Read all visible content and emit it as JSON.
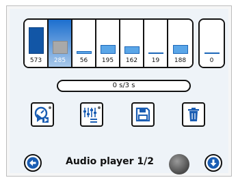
{
  "meters": [
    {
      "value": "573",
      "level": 0.82
    },
    {
      "value": "285",
      "level": 0.41
    },
    {
      "value": "56",
      "level": 0.08
    },
    {
      "value": "195",
      "level": 0.28
    },
    {
      "value": "162",
      "level": 0.23
    },
    {
      "value": "19",
      "level": 0.03
    },
    {
      "value": "188",
      "level": 0.27
    }
  ],
  "selected_meter_index": 1,
  "mute_meter": {
    "value": "0",
    "level": 0.02
  },
  "time": "0 s/3 s",
  "title": "Audio player 1/2",
  "icons": {
    "play": "play-timer-icon",
    "equalizer": "equalizer-icon",
    "save": "save-icon",
    "delete": "trash-icon",
    "back": "back-arrow-icon",
    "download": "download-arrow-icon"
  },
  "colors": {
    "accent": "#1d6fcf",
    "bar": "#5aa6e8",
    "selected_bar": "#a9a9a9",
    "indicator": "#4a4a4a"
  }
}
